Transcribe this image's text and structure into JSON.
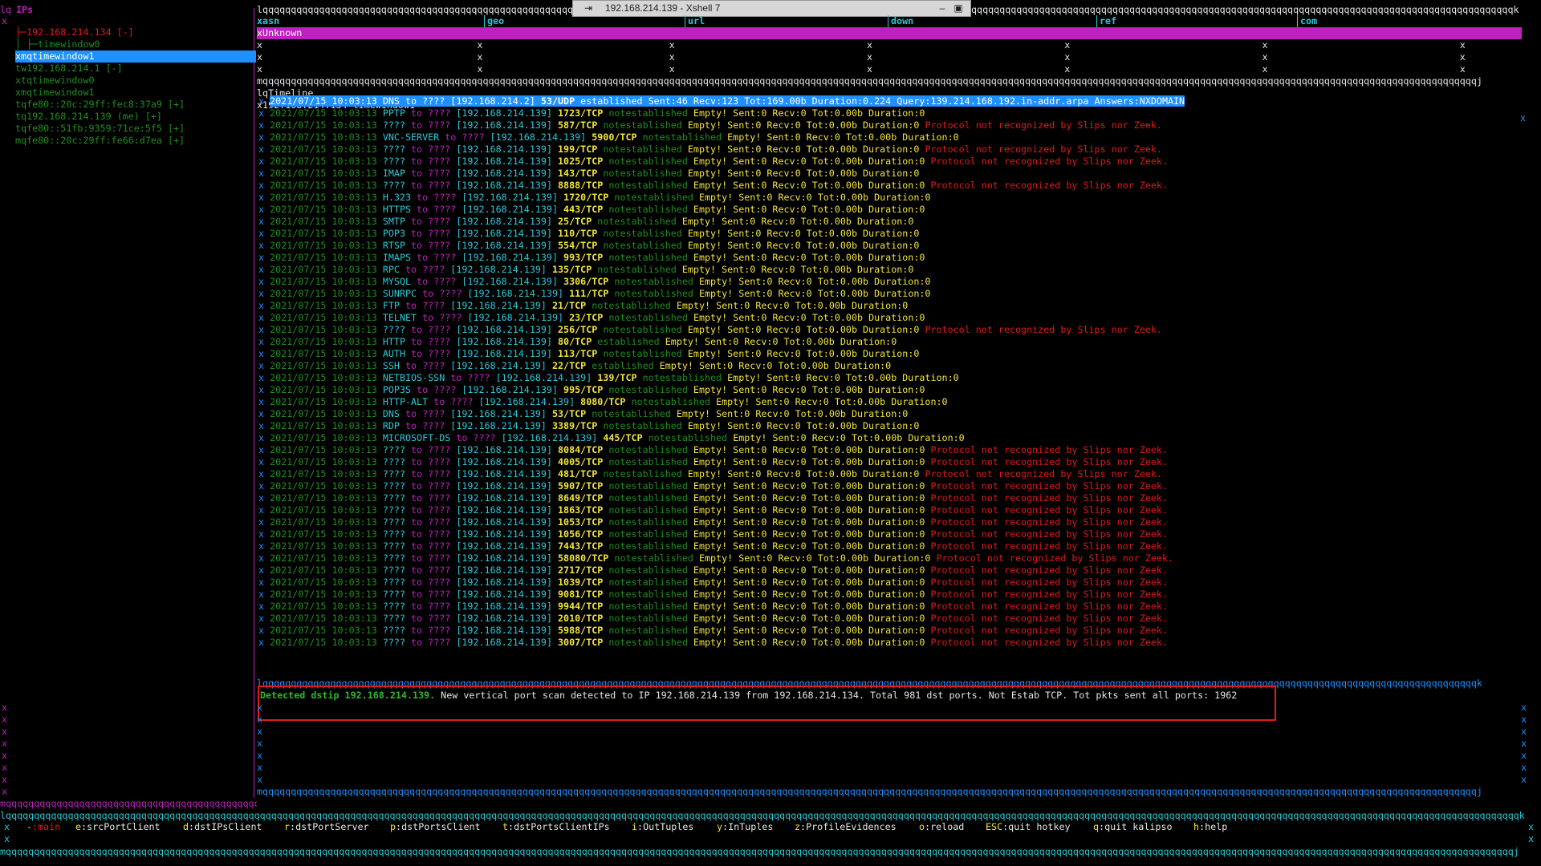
{
  "window": {
    "title": "192.168.214.139 - Xshell 7",
    "pin_icon": "pin-icon",
    "minimize_glyph": "–",
    "restore_glyph": "▣"
  },
  "ips_panel": {
    "title": "IPs",
    "items": [
      {
        "label": "├─192.168.214.134 [-]",
        "color": "#e01b1b"
      },
      {
        "label": "│ ├─timewindow0",
        "color": "#1f8f1f"
      },
      {
        "label": "xmqtimewindow1",
        "color": "#ffffff",
        "selected": true
      },
      {
        "label": "tw192.168.214.1 [-]",
        "color": "#1f8f1f"
      },
      {
        "label": "xtqtimewindow0",
        "color": "#1f8f1f"
      },
      {
        "label": "xmqtimewindow1",
        "color": "#1f8f1f"
      },
      {
        "label": "tqfe80::20c:29ff:fec8:37a9 [+]",
        "color": "#1f8f1f"
      },
      {
        "label": "tq192.168.214.139 (me) [+]",
        "color": "#1f8f1f"
      },
      {
        "label": "tqfe80::51fb:9359:71ce:5f5 [+]",
        "color": "#1f8f1f"
      },
      {
        "label": "mqfe80::20c:29ff:fe66:d7ea [+]",
        "color": "#1f8f1f"
      }
    ]
  },
  "info_table": {
    "headers": [
      "xasn",
      "geo",
      "url",
      "down",
      "ref",
      "com"
    ],
    "first_value": "xUnknown"
  },
  "timeline": {
    "title": "Timeline",
    "subtitle": "192.168.214.134 timewindow1",
    "rows": [
      {
        "ts": "2021/07/15 10:03:13",
        "proto": "DNS",
        "dst": "192.168.214.2",
        "port": "53/UDP",
        "state": "established",
        "rest": "Sent:46 Recv:123 Tot:169.00b Duration:0.224 Query:139.214.168.192.in-addr.arpa Answers:NXDOMAIN",
        "note": ""
      },
      {
        "ts": "2021/07/15 10:03:13",
        "proto": "PPTP",
        "dst": "192.168.214.139",
        "port": "1723/TCP",
        "state": "notestablished",
        "rest": "",
        "note": ""
      },
      {
        "ts": "2021/07/15 10:03:13",
        "proto": "????",
        "dst": "192.168.214.139",
        "port": "587/TCP",
        "state": "notestablished",
        "rest": "",
        "note": "Protocol not recognized by Slips nor Zeek."
      },
      {
        "ts": "2021/07/15 10:03:13",
        "proto": "VNC-SERVER",
        "dst": "192.168.214.139",
        "port": "5900/TCP",
        "state": "notestablished",
        "rest": "",
        "note": ""
      },
      {
        "ts": "2021/07/15 10:03:13",
        "proto": "????",
        "dst": "192.168.214.139",
        "port": "199/TCP",
        "state": "notestablished",
        "rest": "",
        "note": "Protocol not recognized by Slips nor Zeek."
      },
      {
        "ts": "2021/07/15 10:03:13",
        "proto": "????",
        "dst": "192.168.214.139",
        "port": "1025/TCP",
        "state": "notestablished",
        "rest": "",
        "note": "Protocol not recognized by Slips nor Zeek."
      },
      {
        "ts": "2021/07/15 10:03:13",
        "proto": "IMAP",
        "dst": "192.168.214.139",
        "port": "143/TCP",
        "state": "notestablished",
        "rest": "",
        "note": ""
      },
      {
        "ts": "2021/07/15 10:03:13",
        "proto": "????",
        "dst": "192.168.214.139",
        "port": "8888/TCP",
        "state": "notestablished",
        "rest": "",
        "note": "Protocol not recognized by Slips nor Zeek."
      },
      {
        "ts": "2021/07/15 10:03:13",
        "proto": "H.323",
        "dst": "192.168.214.139",
        "port": "1720/TCP",
        "state": "notestablished",
        "rest": "",
        "note": ""
      },
      {
        "ts": "2021/07/15 10:03:13",
        "proto": "HTTPS",
        "dst": "192.168.214.139",
        "port": "443/TCP",
        "state": "notestablished",
        "rest": "",
        "note": ""
      },
      {
        "ts": "2021/07/15 10:03:13",
        "proto": "SMTP",
        "dst": "192.168.214.139",
        "port": "25/TCP",
        "state": "notestablished",
        "rest": "",
        "note": ""
      },
      {
        "ts": "2021/07/15 10:03:13",
        "proto": "POP3",
        "dst": "192.168.214.139",
        "port": "110/TCP",
        "state": "notestablished",
        "rest": "",
        "note": ""
      },
      {
        "ts": "2021/07/15 10:03:13",
        "proto": "RTSP",
        "dst": "192.168.214.139",
        "port": "554/TCP",
        "state": "notestablished",
        "rest": "",
        "note": ""
      },
      {
        "ts": "2021/07/15 10:03:13",
        "proto": "IMAPS",
        "dst": "192.168.214.139",
        "port": "993/TCP",
        "state": "notestablished",
        "rest": "",
        "note": ""
      },
      {
        "ts": "2021/07/15 10:03:13",
        "proto": "RPC",
        "dst": "192.168.214.139",
        "port": "135/TCP",
        "state": "notestablished",
        "rest": "",
        "note": ""
      },
      {
        "ts": "2021/07/15 10:03:13",
        "proto": "MYSQL",
        "dst": "192.168.214.139",
        "port": "3306/TCP",
        "state": "notestablished",
        "rest": "",
        "note": ""
      },
      {
        "ts": "2021/07/15 10:03:13",
        "proto": "SUNRPC",
        "dst": "192.168.214.139",
        "port": "111/TCP",
        "state": "notestablished",
        "rest": "",
        "note": ""
      },
      {
        "ts": "2021/07/15 10:03:13",
        "proto": "FTP",
        "dst": "192.168.214.139",
        "port": "21/TCP",
        "state": "notestablished",
        "rest": "",
        "note": ""
      },
      {
        "ts": "2021/07/15 10:03:13",
        "proto": "TELNET",
        "dst": "192.168.214.139",
        "port": "23/TCP",
        "state": "notestablished",
        "rest": "",
        "note": ""
      },
      {
        "ts": "2021/07/15 10:03:13",
        "proto": "????",
        "dst": "192.168.214.139",
        "port": "256/TCP",
        "state": "notestablished",
        "rest": "",
        "note": "Protocol not recognized by Slips nor Zeek."
      },
      {
        "ts": "2021/07/15 10:03:13",
        "proto": "HTTP",
        "dst": "192.168.214.139",
        "port": "80/TCP",
        "state": "established",
        "rest": "",
        "note": ""
      },
      {
        "ts": "2021/07/15 10:03:13",
        "proto": "AUTH",
        "dst": "192.168.214.139",
        "port": "113/TCP",
        "state": "notestablished",
        "rest": "",
        "note": ""
      },
      {
        "ts": "2021/07/15 10:03:13",
        "proto": "SSH",
        "dst": "192.168.214.139",
        "port": "22/TCP",
        "state": "established",
        "rest": "",
        "note": ""
      },
      {
        "ts": "2021/07/15 10:03:13",
        "proto": "NETBIOS-SSN",
        "dst": "192.168.214.139",
        "port": "139/TCP",
        "state": "notestablished",
        "rest": "",
        "note": ""
      },
      {
        "ts": "2021/07/15 10:03:13",
        "proto": "POP3S",
        "dst": "192.168.214.139",
        "port": "995/TCP",
        "state": "notestablished",
        "rest": "",
        "note": ""
      },
      {
        "ts": "2021/07/15 10:03:13",
        "proto": "HTTP-ALT",
        "dst": "192.168.214.139",
        "port": "8080/TCP",
        "state": "notestablished",
        "rest": "",
        "note": ""
      },
      {
        "ts": "2021/07/15 10:03:13",
        "proto": "DNS",
        "dst": "192.168.214.139",
        "port": "53/TCP",
        "state": "notestablished",
        "rest": "",
        "note": ""
      },
      {
        "ts": "2021/07/15 10:03:13",
        "proto": "RDP",
        "dst": "192.168.214.139",
        "port": "3389/TCP",
        "state": "notestablished",
        "rest": "",
        "note": ""
      },
      {
        "ts": "2021/07/15 10:03:13",
        "proto": "MICROSOFT-DS",
        "dst": "192.168.214.139",
        "port": "445/TCP",
        "state": "notestablished",
        "rest": "",
        "note": ""
      },
      {
        "ts": "2021/07/15 10:03:13",
        "proto": "????",
        "dst": "192.168.214.139",
        "port": "8084/TCP",
        "state": "notestablished",
        "rest": "",
        "note": "Protocol not recognized by Slips nor Zeek."
      },
      {
        "ts": "2021/07/15 10:03:13",
        "proto": "????",
        "dst": "192.168.214.139",
        "port": "4005/TCP",
        "state": "notestablished",
        "rest": "",
        "note": "Protocol not recognized by Slips nor Zeek."
      },
      {
        "ts": "2021/07/15 10:03:13",
        "proto": "????",
        "dst": "192.168.214.139",
        "port": "481/TCP",
        "state": "notestablished",
        "rest": "",
        "note": "Protocol not recognized by Slips nor Zeek."
      },
      {
        "ts": "2021/07/15 10:03:13",
        "proto": "????",
        "dst": "192.168.214.139",
        "port": "5907/TCP",
        "state": "notestablished",
        "rest": "",
        "note": "Protocol not recognized by Slips nor Zeek."
      },
      {
        "ts": "2021/07/15 10:03:13",
        "proto": "????",
        "dst": "192.168.214.139",
        "port": "8649/TCP",
        "state": "notestablished",
        "rest": "",
        "note": "Protocol not recognized by Slips nor Zeek."
      },
      {
        "ts": "2021/07/15 10:03:13",
        "proto": "????",
        "dst": "192.168.214.139",
        "port": "1863/TCP",
        "state": "notestablished",
        "rest": "",
        "note": "Protocol not recognized by Slips nor Zeek."
      },
      {
        "ts": "2021/07/15 10:03:13",
        "proto": "????",
        "dst": "192.168.214.139",
        "port": "1053/TCP",
        "state": "notestablished",
        "rest": "",
        "note": "Protocol not recognized by Slips nor Zeek."
      },
      {
        "ts": "2021/07/15 10:03:13",
        "proto": "????",
        "dst": "192.168.214.139",
        "port": "1056/TCP",
        "state": "notestablished",
        "rest": "",
        "note": "Protocol not recognized by Slips nor Zeek."
      },
      {
        "ts": "2021/07/15 10:03:13",
        "proto": "????",
        "dst": "192.168.214.139",
        "port": "7443/TCP",
        "state": "notestablished",
        "rest": "",
        "note": "Protocol not recognized by Slips nor Zeek."
      },
      {
        "ts": "2021/07/15 10:03:13",
        "proto": "????",
        "dst": "192.168.214.139",
        "port": "58080/TCP",
        "state": "notestablished",
        "rest": "",
        "note": "Protocol not recognized by Slips nor Zeek."
      },
      {
        "ts": "2021/07/15 10:03:13",
        "proto": "????",
        "dst": "192.168.214.139",
        "port": "2717/TCP",
        "state": "notestablished",
        "rest": "",
        "note": "Protocol not recognized by Slips nor Zeek."
      },
      {
        "ts": "2021/07/15 10:03:13",
        "proto": "????",
        "dst": "192.168.214.139",
        "port": "1039/TCP",
        "state": "notestablished",
        "rest": "",
        "note": "Protocol not recognized by Slips nor Zeek."
      },
      {
        "ts": "2021/07/15 10:03:13",
        "proto": "????",
        "dst": "192.168.214.139",
        "port": "9081/TCP",
        "state": "notestablished",
        "rest": "",
        "note": "Protocol not recognized by Slips nor Zeek."
      },
      {
        "ts": "2021/07/15 10:03:13",
        "proto": "????",
        "dst": "192.168.214.139",
        "port": "9944/TCP",
        "state": "notestablished",
        "rest": "",
        "note": "Protocol not recognized by Slips nor Zeek."
      },
      {
        "ts": "2021/07/15 10:03:13",
        "proto": "????",
        "dst": "192.168.214.139",
        "port": "2010/TCP",
        "state": "notestablished",
        "rest": "",
        "note": "Protocol not recognized by Slips nor Zeek."
      },
      {
        "ts": "2021/07/15 10:03:13",
        "proto": "????",
        "dst": "192.168.214.139",
        "port": "5988/TCP",
        "state": "notestablished",
        "rest": "",
        "note": "Protocol not recognized by Slips nor Zeek."
      },
      {
        "ts": "2021/07/15 10:03:13",
        "proto": "????",
        "dst": "192.168.214.139",
        "port": "3007/TCP",
        "state": "notestablished",
        "rest": "",
        "note": "Protocol not recognized by Slips nor Zeek."
      }
    ],
    "empty_stats": "Empty! Sent:0 Recv:0 Tot:0.00b Duration:0"
  },
  "evidence": {
    "highlight": "Detected dstip 192.168.214.139.",
    "text": " New vertical port scan detected to IP 192.168.214.139 from 192.168.214.134. Total 981 dst ports. Not Estab TCP. Tot pkts sent all ports: 1962"
  },
  "hotkeys": [
    {
      "key": "-",
      "label": ":main"
    },
    {
      "key": "e",
      "label": ":srcPortClient"
    },
    {
      "key": "d",
      "label": ":dstIPsClient"
    },
    {
      "key": "r",
      "label": ":dstPortServer"
    },
    {
      "key": "p",
      "label": ":dstPortsClient"
    },
    {
      "key": "t",
      "label": ":dstPortsClientIPs"
    },
    {
      "key": "i",
      "label": ":OutTuples"
    },
    {
      "key": "y",
      "label": ":InTuples"
    },
    {
      "key": "z",
      "label": ":ProfileEvidences"
    },
    {
      "key": "o",
      "label": ":reload"
    },
    {
      "key": "ESC",
      "label": ":quit hotkey"
    },
    {
      "key": "q",
      "label": ":quit kalipso"
    },
    {
      "key": "h",
      "label": ":help"
    }
  ]
}
